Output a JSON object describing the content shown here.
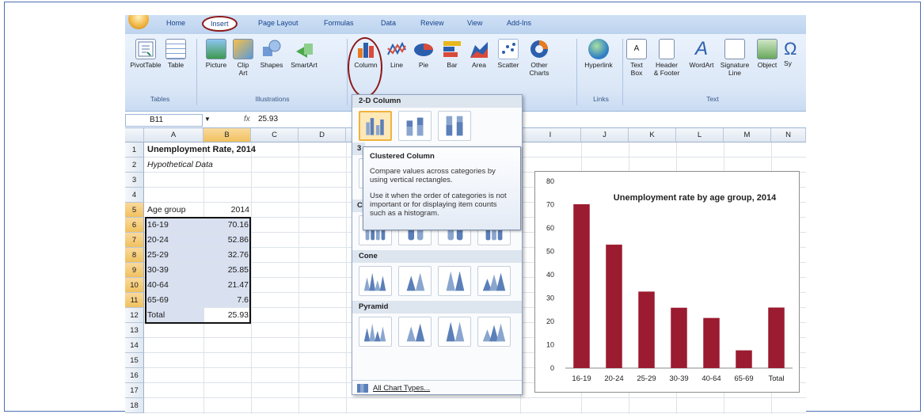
{
  "tabs": [
    "Home",
    "Insert",
    "Page Layout",
    "Formulas",
    "Data",
    "Review",
    "View",
    "Add-Ins"
  ],
  "ribbon": {
    "pivot": "PivotTable",
    "table": "Table",
    "picture": "Picture",
    "clipart_1": "Clip",
    "clipart_2": "Art",
    "shapes": "Shapes",
    "smartart": "SmartArt",
    "column": "Column",
    "line": "Line",
    "pie": "Pie",
    "bar": "Bar",
    "area": "Area",
    "scatter": "Scatter",
    "other_1": "Other",
    "other_2": "Charts",
    "hyperlink": "Hyperlink",
    "textbox_1": "Text",
    "textbox_2": "Box",
    "header_1": "Header",
    "header_2": "& Footer",
    "wordart": "WordArt",
    "signature_1": "Signature",
    "signature_2": "Line",
    "object": "Object",
    "symbol": "Sy",
    "grp_tables": "Tables",
    "grp_illustrations": "Illustrations",
    "grp_links": "Links",
    "grp_text": "Text"
  },
  "formula_bar": {
    "name_box": "B11",
    "fx": "fx",
    "value": "25.93"
  },
  "columns": [
    "A",
    "B",
    "C",
    "D",
    "I",
    "J",
    "K",
    "L",
    "M",
    "N"
  ],
  "rows": [
    "1",
    "2",
    "3",
    "4",
    "5",
    "6",
    "7",
    "8",
    "9",
    "10",
    "11",
    "12",
    "13",
    "14",
    "15",
    "16",
    "17",
    "18"
  ],
  "sheet": {
    "title": "Unemployment Rate, 2014",
    "subtitle": "Hypothetical Data",
    "header_a": "Age group",
    "header_b": "2014",
    "data": [
      {
        "group": "16-19",
        "value": "70.16"
      },
      {
        "group": "20-24",
        "value": "52.86"
      },
      {
        "group": "25-29",
        "value": "32.76"
      },
      {
        "group": "30-39",
        "value": "25.85"
      },
      {
        "group": "40-64",
        "value": "21.47"
      },
      {
        "group": "65-69",
        "value": "7.6"
      },
      {
        "group": "Total",
        "value": "25.93"
      }
    ]
  },
  "dropdown": {
    "section_2d": "2-D Column",
    "section_3d_partial": "3",
    "section_cyl_partial": "C",
    "section_cone": "Cone",
    "section_pyramid": "Pyramid",
    "all_types": "All Chart Types..."
  },
  "tooltip": {
    "title": "Clustered Column",
    "line1": "Compare values across categories by using vertical rectangles.",
    "line2": "Use it when the order of categories is not important or for displaying item counts such as a histogram."
  },
  "chart_data": {
    "type": "bar",
    "title": "Unemployment rate by age group, 2014",
    "categories": [
      "16-19",
      "20-24",
      "25-29",
      "30-39",
      "40-64",
      "65-69",
      "Total"
    ],
    "values": [
      70.16,
      52.86,
      32.76,
      25.85,
      21.47,
      7.6,
      25.93
    ],
    "ylim": [
      0,
      80
    ],
    "yticks": [
      0,
      10,
      20,
      30,
      40,
      50,
      60,
      70,
      80
    ],
    "grid": false,
    "bar_color": "#9b1b30"
  },
  "colors": {
    "accent_ring": "#8b1a1a",
    "ribbon_bg": "#dbe7f7"
  }
}
